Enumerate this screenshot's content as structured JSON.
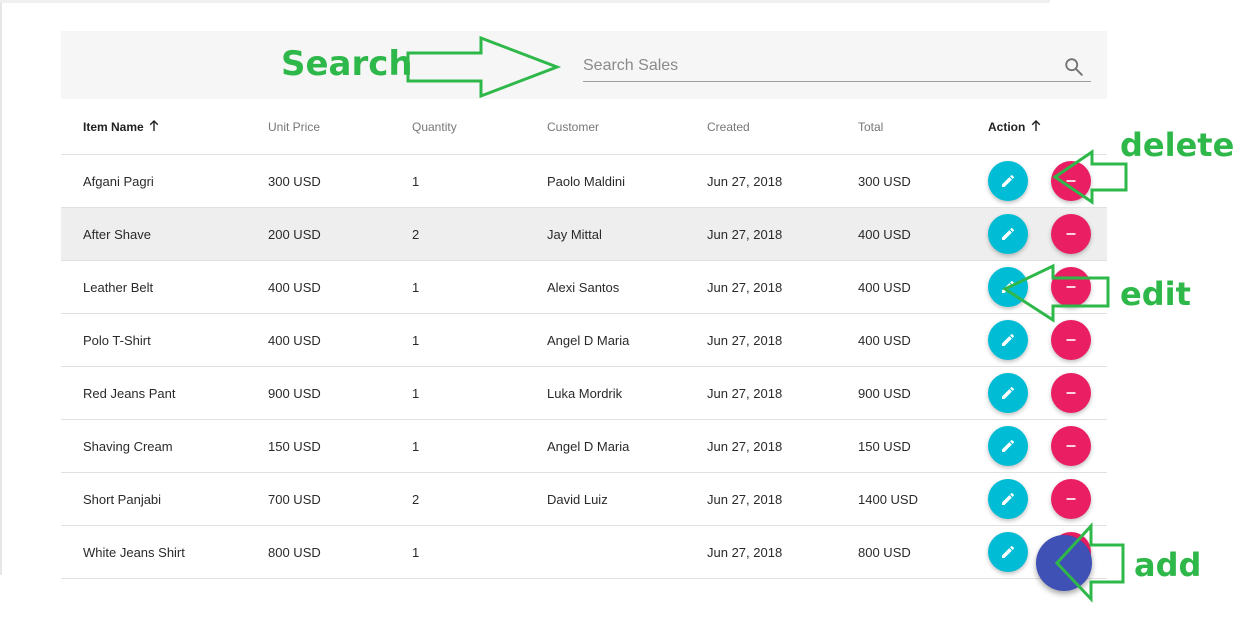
{
  "search": {
    "placeholder": "Search Sales",
    "value": "",
    "icon": "search-icon"
  },
  "table": {
    "headers": {
      "item_name": "Item Name",
      "unit_price": "Unit Price",
      "quantity": "Quantity",
      "customer": "Customer",
      "created": "Created",
      "total": "Total",
      "action": "Action"
    },
    "sorted_columns": [
      "Item Name",
      "Action"
    ],
    "hovered_row": "After Shave",
    "rows": [
      {
        "item_name": "Afgani Pagri",
        "unit_price": "300 USD",
        "quantity": "1",
        "customer": "Paolo Maldini",
        "created": "Jun 27, 2018",
        "total": "300 USD"
      },
      {
        "item_name": "After Shave",
        "unit_price": "200 USD",
        "quantity": "2",
        "customer": "Jay Mittal",
        "created": "Jun 27, 2018",
        "total": "400 USD"
      },
      {
        "item_name": "Leather Belt",
        "unit_price": "400 USD",
        "quantity": "1",
        "customer": "Alexi Santos",
        "created": "Jun 27, 2018",
        "total": "400 USD"
      },
      {
        "item_name": "Polo T-Shirt",
        "unit_price": "400 USD",
        "quantity": "1",
        "customer": "Angel D Maria",
        "created": "Jun 27, 2018",
        "total": "400 USD"
      },
      {
        "item_name": "Red Jeans Pant",
        "unit_price": "900 USD",
        "quantity": "1",
        "customer": "Luka Mordrik",
        "created": "Jun 27, 2018",
        "total": "900 USD"
      },
      {
        "item_name": "Shaving Cream",
        "unit_price": "150 USD",
        "quantity": "1",
        "customer": "Angel D Maria",
        "created": "Jun 27, 2018",
        "total": "150 USD"
      },
      {
        "item_name": "Short Panjabi",
        "unit_price": "700 USD",
        "quantity": "2",
        "customer": "David Luiz",
        "created": "Jun 27, 2018",
        "total": "1400 USD"
      },
      {
        "item_name": "White Jeans Shirt",
        "unit_price": "800 USD",
        "quantity": "1",
        "customer": "",
        "created": "Jun 27, 2018",
        "total": "800 USD"
      }
    ]
  },
  "actions": {
    "edit_icon": "pencil-icon",
    "delete_icon": "minus-icon",
    "add_icon": "add-icon"
  },
  "annotations": {
    "search": "Search",
    "delete": "delete",
    "edit": "edit",
    "add": "add"
  },
  "colors": {
    "edit_button": "#00bcd4",
    "delete_button": "#e91e63",
    "add_button": "#3f51b5",
    "annotation": "#2fb84a",
    "hover_row": "#eeeeee"
  }
}
